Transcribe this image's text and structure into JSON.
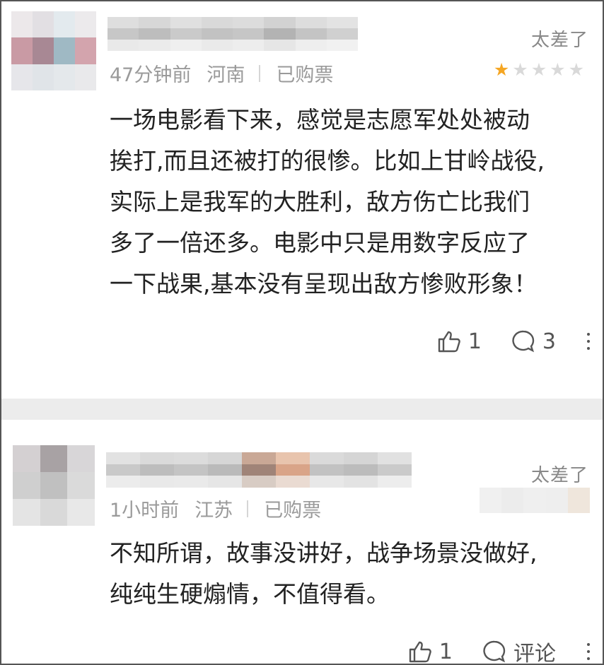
{
  "comments": [
    {
      "rating_label": "太差了",
      "time": "47分钟前",
      "location": "河南",
      "purchase_badge": "已购票",
      "stars_filled": 1,
      "stars_total": 5,
      "text": "一场电影看下来，感觉是志愿军处处被动\n挨打,而且还被打的很惨。比如上甘岭战役,\n实际上是我军的大胜利，敌方伤亡比我们\n多了一倍还多。电影中只是用数字反应了\n一下战果,基本没有呈现出敌方惨败形象！",
      "likes": "1",
      "comments_count": "3"
    },
    {
      "rating_label": "太差了",
      "time": "1小时前",
      "location": "江苏",
      "purchase_badge": "已购票",
      "text": "不知所谓，故事没讲好，战争场景没做好,\n纯纯生硬煽情，不值得看。",
      "likes": "1",
      "comment_label": "评论"
    }
  ],
  "colors": {
    "star_active": "#f5a623",
    "star_inactive": "#d9d9d9",
    "separator": "#ececec"
  }
}
